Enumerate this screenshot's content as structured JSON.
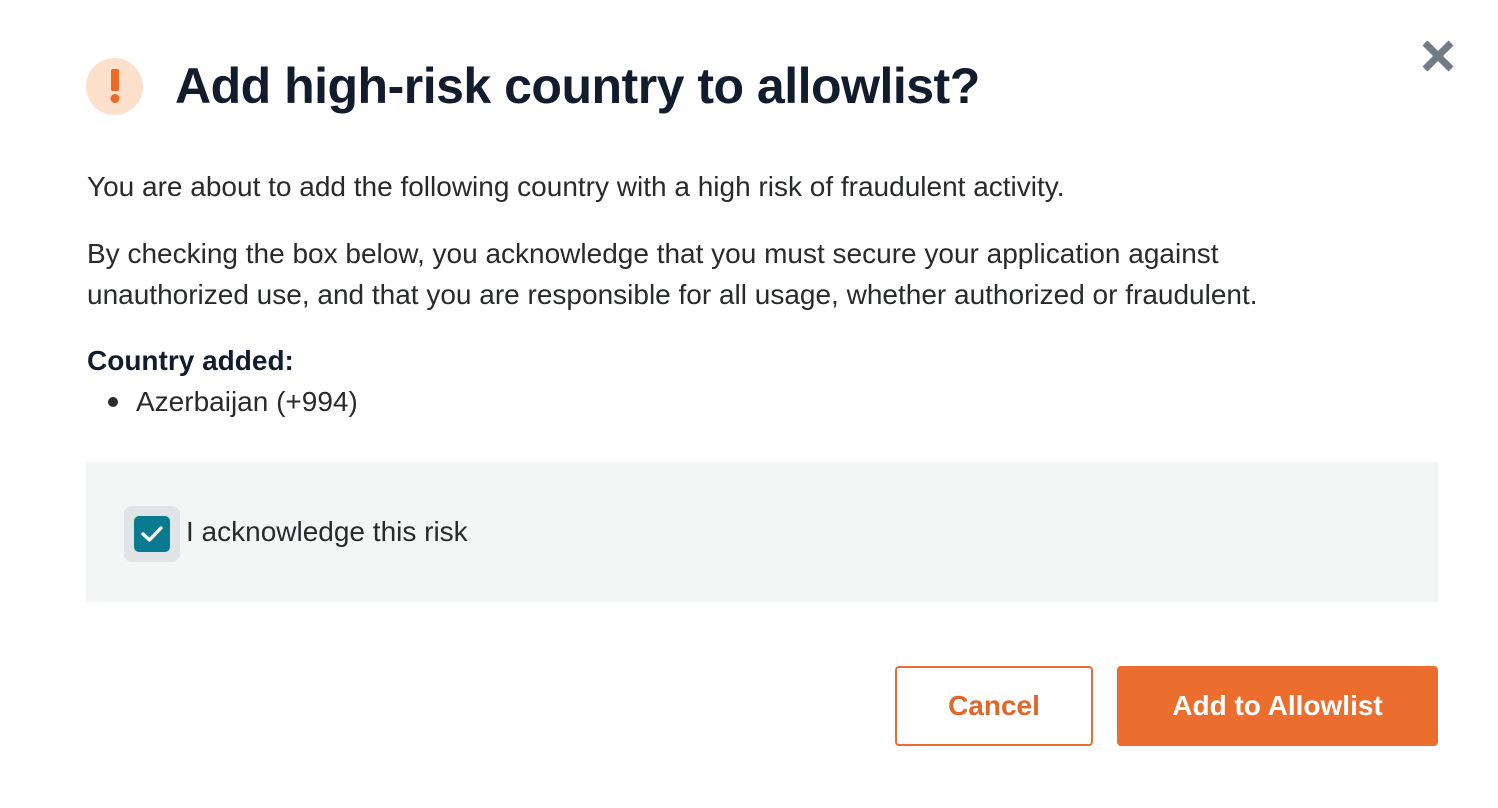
{
  "dialog": {
    "title": "Add high-risk country to allowlist?",
    "alert_icon": "exclamation-icon",
    "close_icon": "close-icon",
    "paragraph_1": "You are about to add the following country with a high risk of fraudulent activity.",
    "paragraph_2": "By checking the box below, you acknowledge that you must secure your application against unauthorized use, and that you are responsible for all usage, whether authorized or fraudulent.",
    "country_label": "Country added:",
    "countries": [
      "Azerbaijan (+994)"
    ],
    "acknowledge": {
      "label": "I acknowledge this risk",
      "checked": true
    },
    "buttons": {
      "cancel": "Cancel",
      "confirm": "Add to Allowlist"
    }
  },
  "colors": {
    "accent_orange": "#eb6e2e",
    "alert_bg": "#fde0cb",
    "checkbox_teal": "#0a7b8f",
    "title": "#121c2d",
    "panel_bg": "#f4f6f6"
  }
}
